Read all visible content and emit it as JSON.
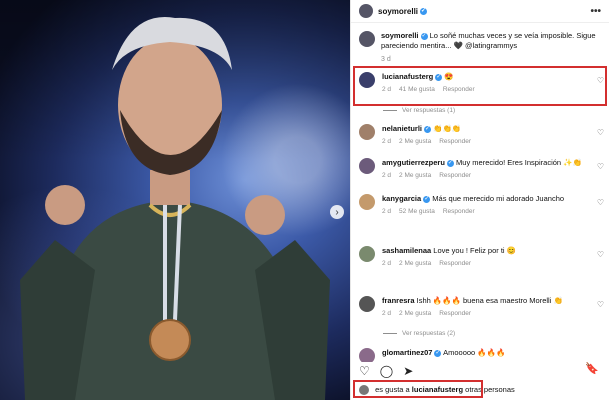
{
  "post": {
    "header_username": "soymorelli",
    "caption_username": "soymorelli",
    "caption_text": "Lo soñé muchas veces y se veía imposible. Sigue pareciendo mentira... 🖤 @latingrammys",
    "caption_time": "3 d",
    "more_icon": "ellipsis-icon"
  },
  "comments": [
    {
      "user": "lucianafusterg",
      "verified": true,
      "text": "😍",
      "time": "2 d",
      "likes": "41 Me gusta",
      "reply": "Responder",
      "avatar_color": "#3a3f6b"
    },
    {
      "user": "nelanieturli",
      "verified": true,
      "text": "👏👏👏",
      "time": "2 d",
      "likes": "2 Me gusta",
      "reply": "Responder",
      "avatar_color": "#a0806a"
    },
    {
      "user": "amygutierrezperu",
      "verified": true,
      "text": "Muy merecido! Eres Inspiración ✨👏",
      "time": "2 d",
      "likes": "2 Me gusta",
      "reply": "Responder",
      "avatar_color": "#6c5b7b"
    },
    {
      "user": "kanygarcia",
      "verified": true,
      "text": "Más que merecido mi adorado Juancho",
      "time": "2 d",
      "likes": "52 Me gusta",
      "reply": "Responder",
      "avatar_color": "#c49a6c"
    },
    {
      "user": "sashamilenaa",
      "verified": false,
      "text": "Love you ! Feliz por ti 😊",
      "time": "2 d",
      "likes": "2 Me gusta",
      "reply": "Responder",
      "avatar_color": "#7a8a6e"
    },
    {
      "user": "franresra",
      "verified": false,
      "text": "Ishh 🔥🔥🔥 buena esa maestro Morelli 👏",
      "time": "2 d",
      "likes": "2 Me gusta",
      "reply": "Responder",
      "avatar_color": "#555555"
    },
    {
      "user": "glomartinez07",
      "verified": true,
      "text": "Amooooo 🔥🔥🔥",
      "time": "",
      "likes": "",
      "reply": "",
      "avatar_color": "#8a6a8a"
    }
  ],
  "view_replies": [
    "Ver respuestas (1)",
    "Ver respuestas (2)"
  ],
  "footer": {
    "likes_prefix": "es gusta a",
    "likes_user": "lucianafusterg",
    "likes_suffix": "otras personas",
    "heart_icon": "heart-icon",
    "comment_icon": "comment-icon",
    "share_icon": "share-icon",
    "bookmark_icon": "bookmark-icon"
  },
  "colors": {
    "highlight": "#d32f2f",
    "verified": "#3897f0"
  }
}
